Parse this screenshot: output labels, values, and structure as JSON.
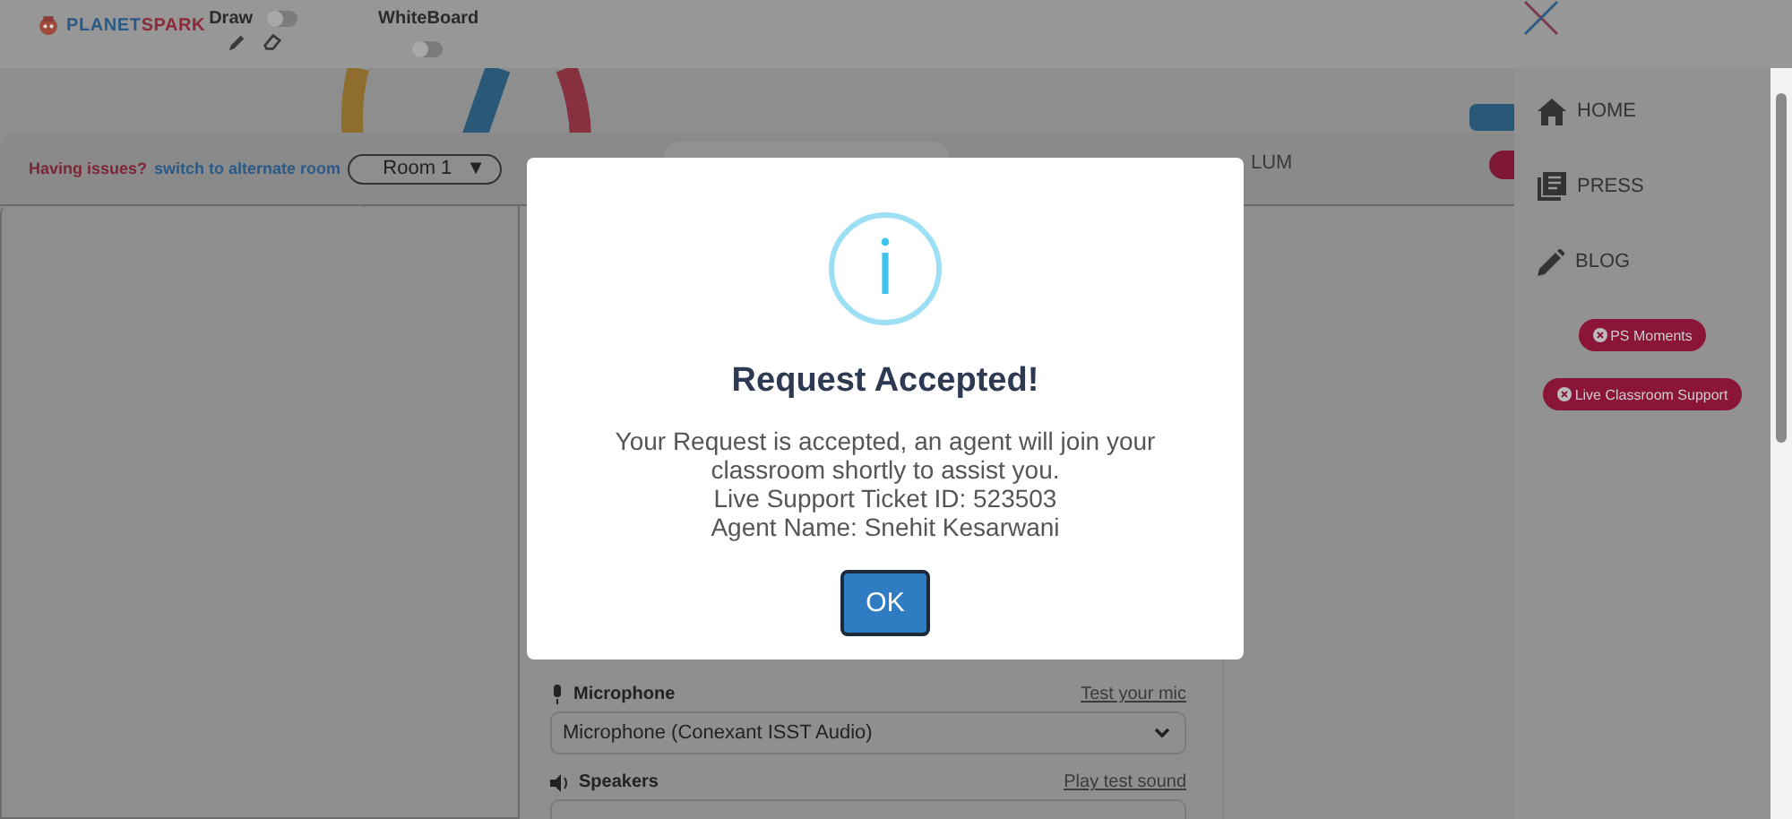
{
  "header": {
    "logo": {
      "text_1": "PLANET",
      "text_2": "SPARK"
    },
    "draw_toggle": {
      "label": "Draw",
      "on": false
    },
    "whiteboard_toggle": {
      "label": "WhiteBoard",
      "on": false
    }
  },
  "room_bar": {
    "issue_text": "Having issues?",
    "switch_link": "switch to alternate room",
    "room_select": {
      "value": "Room 1",
      "arrow": "▼"
    }
  },
  "tab_label": "LUM",
  "sidebar": {
    "items": [
      {
        "label": "HOME",
        "kind": "home"
      },
      {
        "label": "PRESS",
        "kind": "press"
      },
      {
        "label": "BLOG",
        "kind": "blog"
      }
    ],
    "badges": [
      "PS Moments",
      "Live Classroom Support"
    ]
  },
  "audio": {
    "microphone": {
      "label": "Microphone",
      "link": "Test your mic",
      "value": "Microphone (Conexant ISST Audio)"
    },
    "speakers": {
      "label": "Speakers",
      "link": "Play test sound"
    }
  },
  "dialog": {
    "title": "Request Accepted!",
    "lines": [
      "Your Request is accepted, an agent will join your classroom shortly to assist you.",
      "Live Support Ticket ID: 523503",
      "Agent Name: Snehit Kesarwani"
    ],
    "button": "OK"
  }
}
